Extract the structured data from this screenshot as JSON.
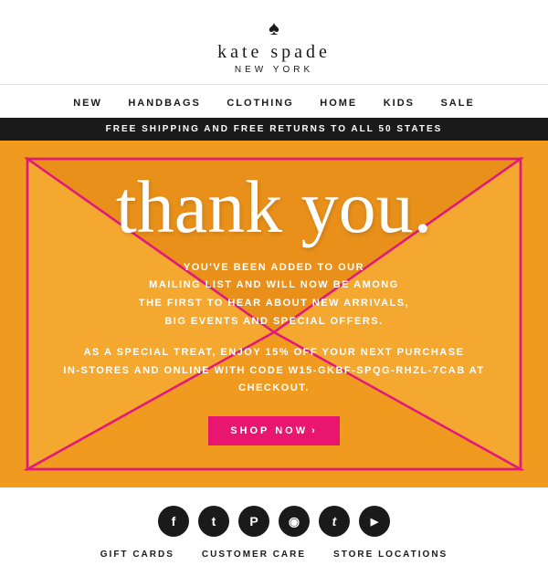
{
  "header": {
    "brand_name": "kate spade",
    "brand_sub": "NEW YORK",
    "spade_symbol": "♠"
  },
  "nav": {
    "items": [
      {
        "label": "NEW",
        "id": "nav-new"
      },
      {
        "label": "HANDBAGS",
        "id": "nav-handbags"
      },
      {
        "label": "CLOTHING",
        "id": "nav-clothing"
      },
      {
        "label": "HOME",
        "id": "nav-home"
      },
      {
        "label": "KIDS",
        "id": "nav-kids"
      },
      {
        "label": "SALE",
        "id": "nav-sale"
      }
    ]
  },
  "banner": {
    "text": "FREE SHIPPING AND FREE RETURNS TO ALL 50 STATES"
  },
  "envelope": {
    "thank_you": "thank you.",
    "message": "YOU'VE BEEN ADDED TO OUR\nMAILING LIST AND WILL NOW BE AMONG\nTHE FIRST TO HEAR ABOUT NEW ARRIVALS,\nBIG EVENTS AND SPECIAL OFFERS.",
    "promo": "AS A SPECIAL TREAT, ENJOY 15% OFF YOUR NEXT PURCHASE\nIN-STORES AND ONLINE WITH CODE W15-GKBF-SPQG-RHZL-7CAB AT\nCHECKOUT.",
    "cta_label": "SHOP NOW",
    "cta_arrow": "›"
  },
  "footer": {
    "social": [
      {
        "name": "facebook",
        "symbol": "f"
      },
      {
        "name": "twitter",
        "symbol": "t"
      },
      {
        "name": "pinterest",
        "symbol": "P"
      },
      {
        "name": "instagram",
        "symbol": "◻"
      },
      {
        "name": "tumblr",
        "symbol": "t"
      },
      {
        "name": "youtube",
        "symbol": "▶"
      }
    ],
    "links": [
      {
        "label": "GIFT CARDS"
      },
      {
        "label": "CUSTOMER CARE"
      },
      {
        "label": "STORE LOCATIONS"
      }
    ]
  }
}
